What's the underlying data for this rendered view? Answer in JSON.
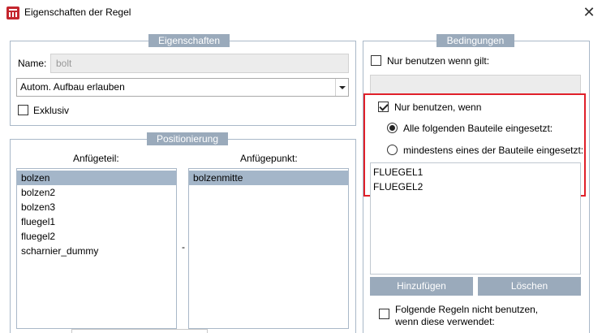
{
  "window": {
    "title": "Eigenschaften der Regel",
    "close_symbol": "✕"
  },
  "eigenschaften": {
    "title": "Eigenschaften",
    "name_label": "Name:",
    "name_value": "bolt",
    "combo_value": "Autom. Aufbau erlauben",
    "exklusiv_label": "Exklusiv",
    "exklusiv_checked": false
  },
  "positionierung": {
    "title": "Positionierung",
    "anfuegeteil_label": "Anfügeteil:",
    "anfuegepunkt_label": "Anfügepunkt:",
    "anfuegeteil_items": [
      "bolzen",
      "bolzen2",
      "bolzen3",
      "fluegel1",
      "fluegel2",
      "scharnier_dummy"
    ],
    "anfuegeteil_selected": "bolzen",
    "anfuegepunkt_items": [
      "bolzenmitte"
    ],
    "anfuegepunkt_selected": "bolzenmitte",
    "separator": "-"
  },
  "bedingungen": {
    "title": "Bedingungen",
    "nur_benutzen_gilt_label": "Nur benutzen wenn gilt:",
    "nur_benutzen_gilt_checked": false,
    "nur_benutzen_wenn_label": "Nur benutzen, wenn",
    "nur_benutzen_wenn_checked": true,
    "radio_alle_label": "Alle folgenden Bauteile eingesetzt:",
    "radio_mindestens_label": "mindestens eines der Bauteile eingesetzt:",
    "radio_selected": "alle",
    "parts": [
      "FLUEGEL1",
      "FLUEGEL2"
    ],
    "add_button": "Hinzufügen",
    "delete_button": "Löschen",
    "folgende_label_line1": "Folgende Regeln nicht benutzen,",
    "folgende_label_line2": "wenn diese verwendet:",
    "folgende_checked": false
  },
  "colors": {
    "group_header": "#9aaabb",
    "selection": "#a4b6c9",
    "highlight_border": "#e0202a"
  }
}
